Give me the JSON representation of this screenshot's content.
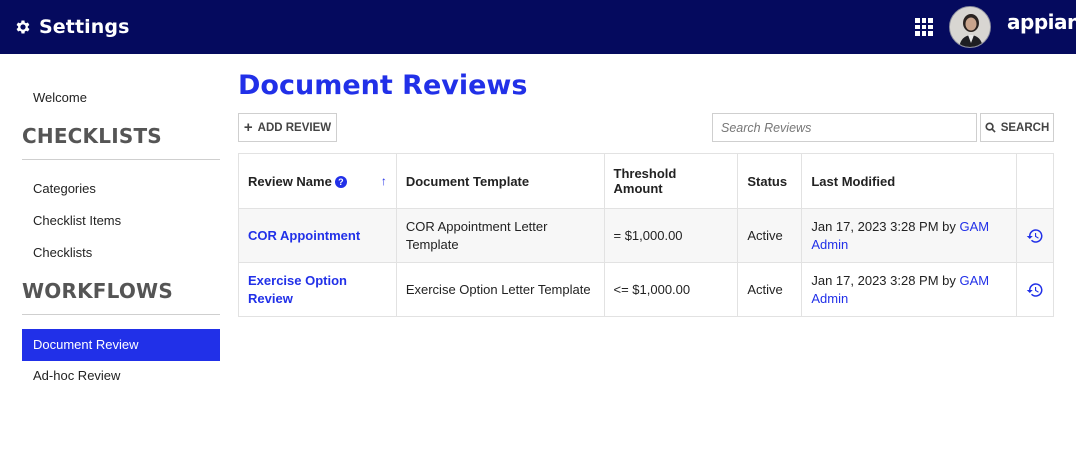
{
  "header": {
    "title": "Settings",
    "brand": "appian"
  },
  "sidebar": {
    "items": [
      {
        "label": "Welcome"
      },
      {
        "label": "Categories"
      },
      {
        "label": "Checklist Items"
      },
      {
        "label": "Checklists"
      },
      {
        "label": "Document Review"
      },
      {
        "label": "Ad-hoc Review"
      }
    ],
    "sections": [
      "CHECKLISTS",
      "WORKFLOWS"
    ]
  },
  "main": {
    "title": "Document Reviews",
    "add_label": "ADD REVIEW",
    "search_placeholder": "Search Reviews",
    "search_label": "SEARCH"
  },
  "table": {
    "columns": [
      "Review Name",
      "Document Template",
      "Threshold Amount",
      "Status",
      "Last Modified"
    ],
    "rows": [
      {
        "name": "COR Appointment",
        "template": "COR Appointment Letter Template",
        "threshold": "= $1,000.00",
        "status": "Active",
        "modified_text": "Jan 17, 2023 3:28 PM by ",
        "modified_user": "GAM Admin"
      },
      {
        "name": "Exercise Option Review",
        "template": "Exercise Option Letter Template",
        "threshold": "<= $1,000.00",
        "status": "Active",
        "modified_text": "Jan 17, 2023 3:28 PM by ",
        "modified_user": "GAM Admin"
      }
    ]
  },
  "colors": {
    "topbar": "#050a5e",
    "accent": "#2130e8"
  }
}
